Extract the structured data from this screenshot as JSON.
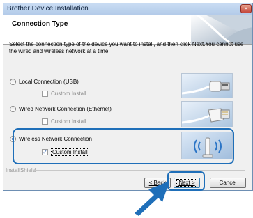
{
  "window": {
    "title": "Brother Device Installation",
    "close_glyph": "×"
  },
  "header": {
    "title": "Connection Type"
  },
  "instructions": "Select the connection type of the device you want to install, and then click Next.You cannot use the wired and wireless network at a time.",
  "options": [
    {
      "label": "Local Connection (USB)",
      "selected": false,
      "custom_install_label": "Custom Install",
      "custom_install_checked": false,
      "icon": "usb-cable-icon"
    },
    {
      "label": "Wired Network Connection (Ethernet)",
      "selected": false,
      "custom_install_label": "Custom Install",
      "custom_install_checked": false,
      "icon": "ethernet-cable-icon"
    },
    {
      "label": "Wireless Network Connection",
      "selected": true,
      "custom_install_label": "Custom Install",
      "custom_install_checked": true,
      "icon": "wireless-antenna-icon"
    }
  ],
  "footer": {
    "brand": "InstallShield"
  },
  "buttons": {
    "back": "< Back",
    "next": "Next >",
    "cancel": "Cancel"
  },
  "colors": {
    "highlight": "#1f6fb9",
    "arrow": "#1f6fb9"
  }
}
